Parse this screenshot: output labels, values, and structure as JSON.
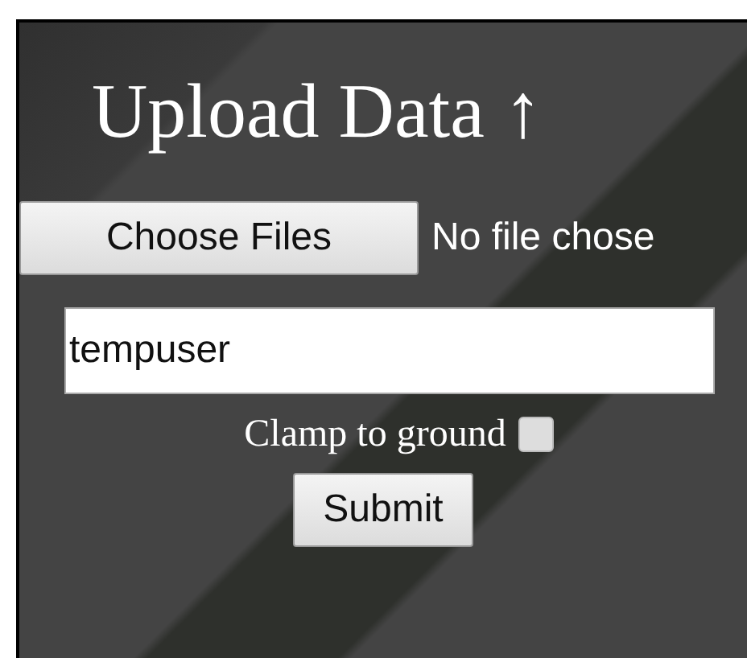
{
  "title": "Upload Data ↑",
  "file_picker": {
    "button": "Choose Files",
    "status": "No file chose"
  },
  "user_field": {
    "value": "tempuser"
  },
  "clamp_option": {
    "label": "Clamp to ground",
    "checked": false
  },
  "submit_button": "Submit"
}
